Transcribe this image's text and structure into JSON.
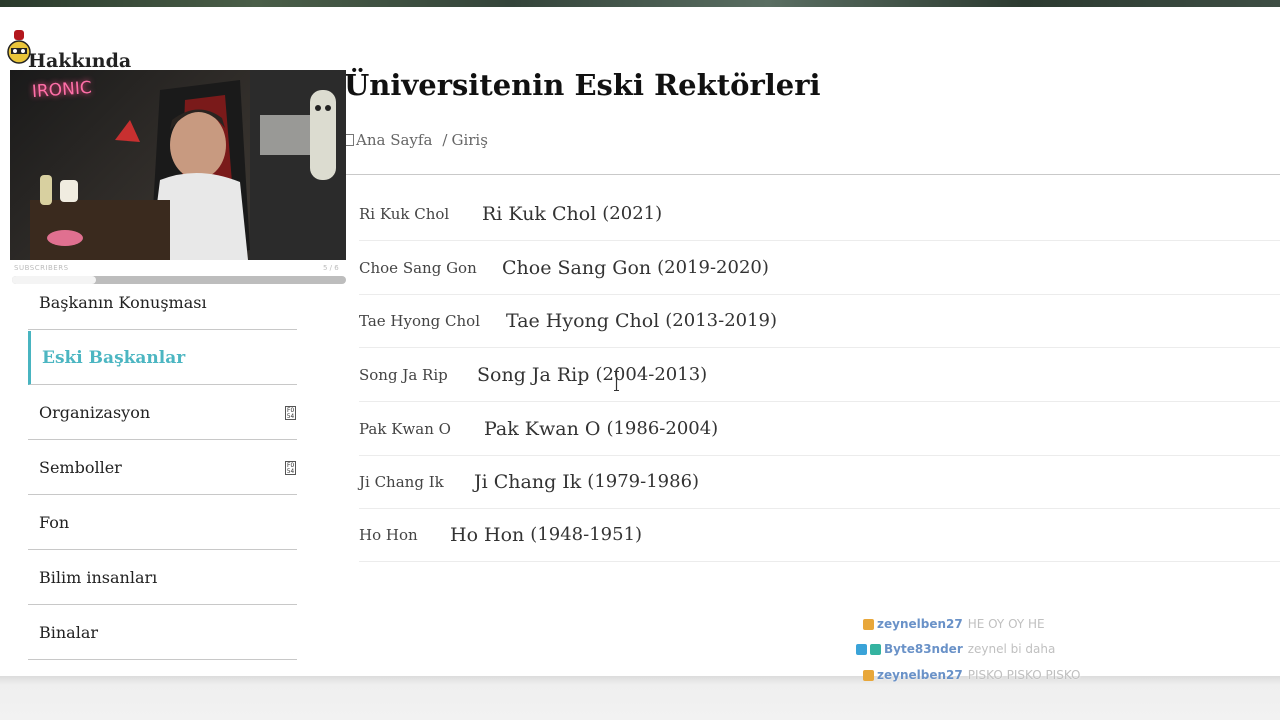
{
  "sidebar": {
    "title": "Hakkında",
    "items": [
      {
        "label": "Başkanın Konuşması",
        "active": false,
        "has_icon": false
      },
      {
        "label": "Eski Başkanlar",
        "active": true,
        "has_icon": false
      },
      {
        "label": "Organizasyon",
        "active": false,
        "has_icon": true
      },
      {
        "label": "Semboller",
        "active": false,
        "has_icon": true
      },
      {
        "label": "Fon",
        "active": false,
        "has_icon": false
      },
      {
        "label": "Bilim insanları",
        "active": false,
        "has_icon": false
      },
      {
        "label": "Binalar",
        "active": false,
        "has_icon": false
      }
    ]
  },
  "main": {
    "title": "Üniversitenin Eski Rektörleri",
    "breadcrumb": {
      "home": "Ana Sayfa",
      "separator": "/",
      "current": "Giriş"
    },
    "rectors": [
      {
        "thumb": "Ri Kuk Chol",
        "name": "Ri Kuk Chol",
        "years": "(2021)"
      },
      {
        "thumb": "Choe Sang Gon",
        "name": "Choe Sang Gon",
        "years": "(2019-2020)"
      },
      {
        "thumb": "Tae Hyong Chol",
        "name": "Tae Hyong Chol",
        "years": "(2013-2019)"
      },
      {
        "thumb": "Song Ja Rip",
        "name": "Song Ja Rip",
        "years": "(2004-2013)"
      },
      {
        "thumb": "Pak Kwan O",
        "name": "Pak Kwan O",
        "years": "(1986-2004)"
      },
      {
        "thumb": "Ji Chang Ik",
        "name": "Ji Chang Ik",
        "years": "(1979-1986)"
      },
      {
        "thumb": "Ho Hon",
        "name": "Ho Hon",
        "years": "(1948-1951)"
      }
    ]
  },
  "stream_overlay": {
    "webcam_sign": "IRONIC",
    "subs_label": "SUBSCRIBERS",
    "subs_count": "5 / 6",
    "subs_progress": 0.25
  },
  "chat": [
    {
      "user": "zeynelben27",
      "message": "HE OY OY HE",
      "badge": "subscriber-badge"
    },
    {
      "user": "Byte83nder",
      "message": "zeynel bi daha",
      "badge": "prime-badge"
    },
    {
      "user": "zeynelben27",
      "message": "PISKO PISKO PISKO",
      "badge": "subscriber-badge"
    }
  ],
  "colors": {
    "accent": "#4cb6c2",
    "chat_user": "#6a92c8",
    "neon": "#ff6fa8"
  }
}
